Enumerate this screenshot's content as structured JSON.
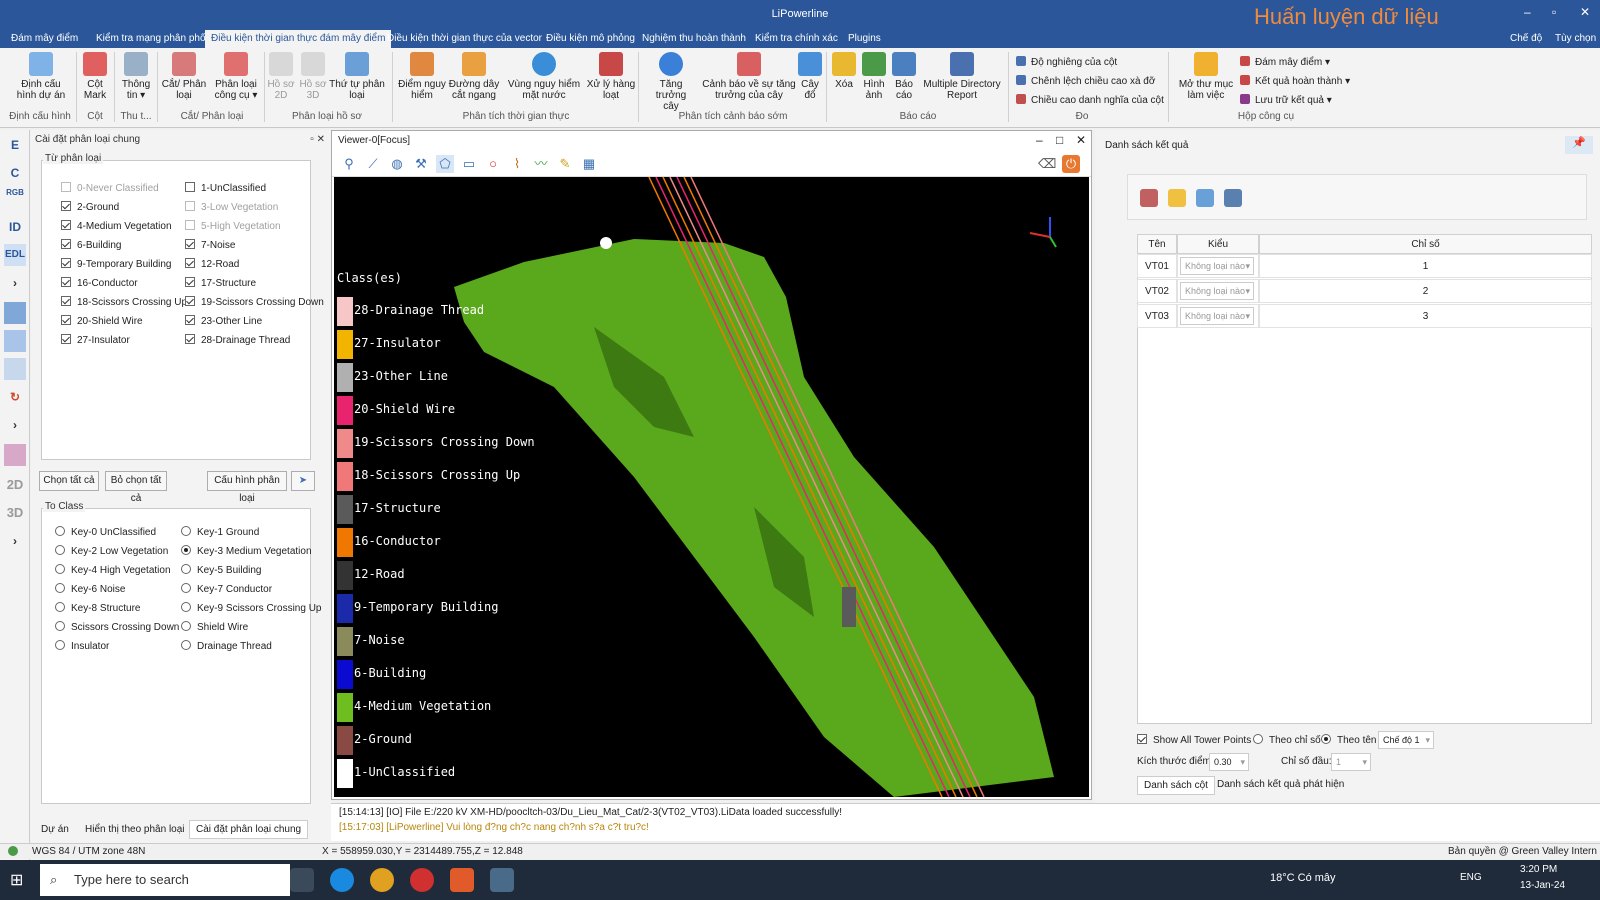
{
  "title": {
    "app": "LiPowerline",
    "brand_overlay": "Huấn luyện dữ liệu",
    "right_links": [
      "Chế độ",
      "Tùy chọn"
    ]
  },
  "menu_tabs": [
    "Đám mây điểm",
    "Kiểm tra mạng phân phối",
    "Điều kiện thời gian thực đám mây điểm",
    "Điều kiện thời gian thực của vector",
    "Điều kiện mô phỏng",
    "Nghiệm thu hoàn thành",
    "Kiểm tra chính xác",
    "Plugins"
  ],
  "ribbon": {
    "buttons": [
      {
        "label1": "Định cấu",
        "label2": "hình dự án"
      },
      {
        "label1": "Cột",
        "label2": "Mark"
      },
      {
        "label1": "Thông",
        "label2": "tin ▾"
      },
      {
        "label1": "Cắt/ Phân",
        "label2": "loại"
      },
      {
        "label1": "Phân loại",
        "label2": "công cụ ▾"
      },
      {
        "label1": "Hồ sơ",
        "label2": "2D"
      },
      {
        "label1": "Hồ sơ",
        "label2": "3D"
      },
      {
        "label1": "Thứ tự phân",
        "label2": "loại"
      },
      {
        "label1": "Điểm nguy",
        "label2": "hiểm"
      },
      {
        "label1": "Đường dây",
        "label2": "cắt ngang"
      },
      {
        "label1": "Vùng nguy hiểm",
        "label2": "mặt nước"
      },
      {
        "label1": "Xử lý hàng",
        "label2": "loạt"
      },
      {
        "label1": "Tăng trưởng",
        "label2": "cây"
      },
      {
        "label1": "Cảnh báo về sự tăng",
        "label2": "trưởng của cây"
      },
      {
        "label1": "Cây",
        "label2": "đổ"
      },
      {
        "label1": "Xóa",
        "label2": ""
      },
      {
        "label1": "Hình",
        "label2": "ảnh"
      },
      {
        "label1": "Báo",
        "label2": "cáo"
      },
      {
        "label1": "Multiple Directory",
        "label2": "Report"
      },
      {
        "label1": "Mở thư mục",
        "label2": "làm việc"
      }
    ],
    "groups": [
      "Định cấu hình",
      "Cột",
      "Thu t...",
      "Cắt/ Phân loại",
      "Phân loại hồ sơ",
      "Phân tích thời gian thực",
      "Phân tích cảnh báo sớm",
      "Báo cáo",
      "Đo",
      "Hộp công cụ"
    ],
    "measure_items": [
      "Độ nghiêng của cột",
      "Chênh lệch chiều cao xà đỡ",
      "Chiều cao danh nghĩa của cột"
    ],
    "toolbox_items": [
      "Đám mây điểm ▾",
      "Kết quả hoàn thành ▾",
      "Lưu trữ kết quả ▾"
    ]
  },
  "left_toolbar": [
    "E",
    "C",
    "RGB",
    "ID",
    "EDL",
    "2D",
    "3D"
  ],
  "left_panel": {
    "header": "Cài đặt phân loại chung",
    "from_title": "Từ phân loại",
    "from_classes": [
      {
        "label": "0-Never Classified",
        "checked": false,
        "disabled": true
      },
      {
        "label": "1-UnClassified",
        "checked": false,
        "disabled": false
      },
      {
        "label": "2-Ground",
        "checked": true,
        "disabled": false
      },
      {
        "label": "3-Low Vegetation",
        "checked": false,
        "disabled": true
      },
      {
        "label": "4-Medium Vegetation",
        "checked": true,
        "disabled": false
      },
      {
        "label": "5-High Vegetation",
        "checked": false,
        "disabled": true
      },
      {
        "label": "6-Building",
        "checked": true,
        "disabled": false
      },
      {
        "label": "7-Noise",
        "checked": true,
        "disabled": false
      },
      {
        "label": "9-Temporary Building",
        "checked": true,
        "disabled": false
      },
      {
        "label": "12-Road",
        "checked": true,
        "disabled": false
      },
      {
        "label": "16-Conductor",
        "checked": true,
        "disabled": false
      },
      {
        "label": "17-Structure",
        "checked": true,
        "disabled": false
      },
      {
        "label": "18-Scissors Crossing Up",
        "checked": true,
        "disabled": false
      },
      {
        "label": "19-Scissors Crossing Down",
        "checked": true,
        "disabled": false
      },
      {
        "label": "20-Shield Wire",
        "checked": true,
        "disabled": false
      },
      {
        "label": "23-Other Line",
        "checked": true,
        "disabled": false
      },
      {
        "label": "27-Insulator",
        "checked": true,
        "disabled": false
      },
      {
        "label": "28-Drainage Thread",
        "checked": true,
        "disabled": false
      }
    ],
    "buttons": [
      "Chọn tất cả",
      "Bỏ chọn tất cả",
      "Cấu hình phân loại"
    ],
    "to_title": "To Class",
    "to_classes": [
      {
        "label": "Key-0 UnClassified",
        "selected": false
      },
      {
        "label": "Key-1 Ground",
        "selected": false
      },
      {
        "label": "Key-2 Low Vegetation",
        "selected": false
      },
      {
        "label": "Key-3 Medium Vegetation",
        "selected": true
      },
      {
        "label": "Key-4 High Vegetation",
        "selected": false
      },
      {
        "label": "Key-5 Building",
        "selected": false
      },
      {
        "label": "Key-6 Noise",
        "selected": false
      },
      {
        "label": "Key-7 Conductor",
        "selected": false
      },
      {
        "label": "Key-8 Structure",
        "selected": false
      },
      {
        "label": "Key-9 Scissors Crossing Up",
        "selected": false
      },
      {
        "label": "Scissors Crossing Down",
        "selected": false
      },
      {
        "label": "Shield Wire",
        "selected": false
      },
      {
        "label": "Insulator",
        "selected": false
      },
      {
        "label": "Drainage Thread",
        "selected": false
      }
    ],
    "bottom_tabs": [
      "Dự án",
      "Hiển thị theo phân loại",
      "Cài đặt phân loại chung"
    ]
  },
  "viewer": {
    "title": "Viewer-0[Focus]",
    "legend_title": "Class(es)",
    "legend": [
      {
        "label": "28-Drainage Thread",
        "color": "#f7c6c6"
      },
      {
        "label": "27-Insulator",
        "color": "#f3b400"
      },
      {
        "label": "23-Other Line",
        "color": "#b0b0b0"
      },
      {
        "label": "20-Shield Wire",
        "color": "#e8246f"
      },
      {
        "label": "19-Scissors Crossing Down",
        "color": "#f08a8a"
      },
      {
        "label": "18-Scissors Crossing Up",
        "color": "#f07878"
      },
      {
        "label": "17-Structure",
        "color": "#5a5a5a"
      },
      {
        "label": "16-Conductor",
        "color": "#f07800"
      },
      {
        "label": "12-Road",
        "color": "#333333"
      },
      {
        "label": "9-Temporary Building",
        "color": "#1a2aa8"
      },
      {
        "label": "7-Noise",
        "color": "#8a8a5a"
      },
      {
        "label": "6-Building",
        "color": "#0a0ad0"
      },
      {
        "label": "4-Medium Vegetation",
        "color": "#6fbe1f"
      },
      {
        "label": "2-Ground",
        "color": "#8a4a44"
      },
      {
        "label": "1-UnClassified",
        "color": "#ffffff"
      }
    ]
  },
  "right_panel": {
    "header": "Danh sách kết quả",
    "columns": [
      "Tên",
      "Kiểu",
      "Chỉ số"
    ],
    "rows": [
      {
        "name": "VT01",
        "type": "Không loại nào",
        "index": "1"
      },
      {
        "name": "VT02",
        "type": "Không loại nào",
        "index": "2"
      },
      {
        "name": "VT03",
        "type": "Không loại nào",
        "index": "3"
      }
    ],
    "show_all_label": "Show All Tower Points",
    "by_index": "Theo chỉ số",
    "by_name": "Theo tên",
    "mode_value": "Chế độ 1",
    "point_size_label": "Kích thước điểm:",
    "point_size_value": "0.30",
    "start_index_label": "Chỉ số đầu:",
    "start_index_value": "1",
    "tabs": [
      "Danh sách cột",
      "Danh sách kết quả phát hiện"
    ]
  },
  "status": {
    "line1": "[15:14:13] [IO]    File E:/220 kV XM-HD/poocltch-03/Du_Lieu_Mat_Cat/2-3(VT02_VT03).LiData loaded successfully!",
    "line2": "[15:17:03] [LiPowerline]   Vui lòng đ?ng ch?c nang ch?nh s?a c?t tru?c!",
    "crs": "WGS 84 / UTM zone 48N",
    "coords": "X = 558959.030,Y = 2314489.755,Z = 12.848",
    "copyright": "Bản quyền @ Green Valley Intern"
  },
  "taskbar": {
    "search_placeholder": "Type here to search",
    "weather": "18°C  Có mây",
    "lang": "ENG",
    "time": "3:20 PM",
    "date": "13-Jan-24"
  }
}
